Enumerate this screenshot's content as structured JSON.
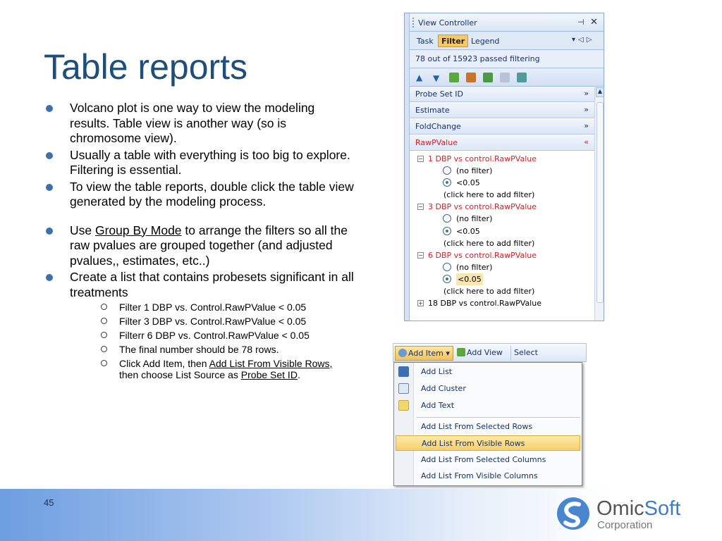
{
  "slide": {
    "title": "Table reports",
    "page_number": "45"
  },
  "bullets": [
    {
      "text": "Volcano plot is one way to view the modeling results. Table view is another way (so is chromosome view)."
    },
    {
      "text": "Usually a table with everything is too big to explore. Filtering is essential."
    },
    {
      "text": "To view the table reports, double click the table view generated by the modeling process."
    },
    {
      "pre": "Use ",
      "link": "Group By Mode",
      "post": " to arrange the filters so all the raw pvalues are grouped together (and adjusted pvalues,, estimates, etc..)"
    },
    {
      "text": "Create a list that contains probesets significant in all treatments"
    }
  ],
  "sub_bullets": [
    {
      "text": "Filter 1 DBP vs. Control.RawPValue < 0.05"
    },
    {
      "text": "Filter 3 DBP vs. Control.RawPValue < 0.05"
    },
    {
      "text": "Filterr 6 DBP vs. Control.RawPValue < 0.05"
    },
    {
      "text": "The final number should be 78 rows."
    },
    {
      "pre": "Click Add Item, then ",
      "link": "Add List From Visible Rows,",
      "mid": " then choose List Source as ",
      "link2": "Probe Set ID",
      "post": "."
    }
  ],
  "logo": {
    "name_a": "Omic",
    "name_b": "Soft",
    "corp": "Corporation"
  },
  "view_controller": {
    "title": "View Controller",
    "pin": "⊣",
    "close": "✕",
    "tabs": [
      "Task",
      "Filter",
      "Legend"
    ],
    "active_tab": "Filter",
    "status": "78 out of 15923 passed filtering",
    "sections": [
      {
        "label": "Probe Set ID",
        "chev": "»",
        "expanded": false
      },
      {
        "label": "Estimate",
        "chev": "»",
        "expanded": false
      },
      {
        "label": "FoldChange",
        "chev": "»",
        "expanded": false
      },
      {
        "label": "RawPValue",
        "chev": "«",
        "expanded": true
      }
    ],
    "tree": [
      {
        "group": "1 DBP vs control.RawPValue",
        "options": [
          "(no filter)",
          "<0.05"
        ],
        "selected": 1,
        "add": "(click here to add filter)"
      },
      {
        "group": "3 DBP vs control.RawPValue",
        "options": [
          "(no filter)",
          "<0.05"
        ],
        "selected": 1,
        "add": "(click here to add filter)"
      },
      {
        "group": "6 DBP vs control.RawPValue",
        "options": [
          "(no filter)",
          "<0.05"
        ],
        "selected": 1,
        "add": "(click here to add filter)"
      },
      {
        "group": "18 DBP vs control.RawPValue",
        "collapsed": true
      }
    ]
  },
  "menu": {
    "toolbar": [
      "Add Item",
      "Add View",
      "Select"
    ],
    "items_a": [
      {
        "label": "Add List",
        "icon": "list-icon"
      },
      {
        "label": "Add Cluster",
        "icon": "cluster-icon"
      },
      {
        "label": "Add Text",
        "icon": "text-note-icon"
      }
    ],
    "items_b": [
      {
        "label": "Add List From Selected Rows"
      },
      {
        "label": "Add List From Visible Rows",
        "highlighted": true
      },
      {
        "label": "Add List From Selected Columns"
      },
      {
        "label": "Add List From Visible Columns"
      }
    ]
  },
  "colors": {
    "title": "#1f4e79",
    "bullet": "#3e6fb0",
    "red_filter": "#d0202a",
    "menu_highlight": "#f7cf6a"
  }
}
